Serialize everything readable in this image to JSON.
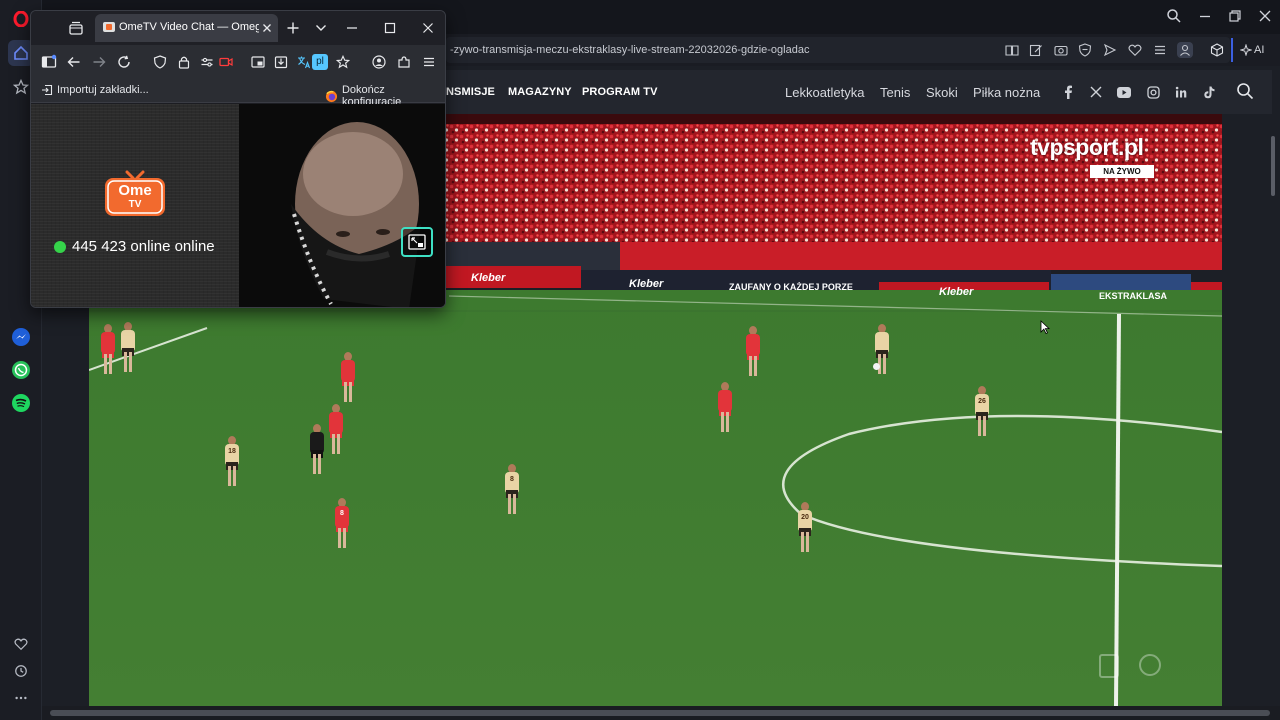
{
  "main_browser": {
    "url": "-zywo-transmisja-meczu-ekstraklasy-live-stream-22032026-gdzie-ogladac",
    "ai_label": "AI"
  },
  "site": {
    "nav_bold": [
      "NSMISJE",
      "MAGAZYNY",
      "PROGRAM TV"
    ],
    "nav_sports": [
      "Lekkoatletyka",
      "Tenis",
      "Skoki",
      "Piłka nożna"
    ],
    "social_icons": [
      "facebook-icon",
      "x-icon",
      "youtube-icon",
      "instagram-icon",
      "linkedin-icon",
      "tiktok-icon"
    ]
  },
  "video": {
    "watermark": "tvpsport.pl",
    "live_badge": "NA ŻYWO",
    "boards": [
      "Kleber",
      "Kleber",
      "ZAUFANY O KAŻDEJ PORZE",
      "Kleber",
      "EKSTRAKLASA"
    ],
    "player_numbers": [
      "18",
      "8",
      "20",
      "26",
      "8",
      "8"
    ]
  },
  "ome_window": {
    "tab_title": "OmeTV Video Chat — Omegle",
    "bookmark_import": "Importuj zakładki...",
    "bookmark_finish": "Dokończ konfigurację",
    "translate_badge": "pl",
    "logo_top": "Ome",
    "logo_bottom": "TV",
    "online_text": "445 423 online online"
  },
  "colors": {
    "ome_orange": "#f26a2e",
    "online_green": "#35d34a",
    "pitch": "#3f7a32",
    "home_kit": "#e2343a",
    "away_kit": "#e9d4a5",
    "opera_red": "#ff1b2d",
    "accent_blue": "#5b8cff"
  }
}
